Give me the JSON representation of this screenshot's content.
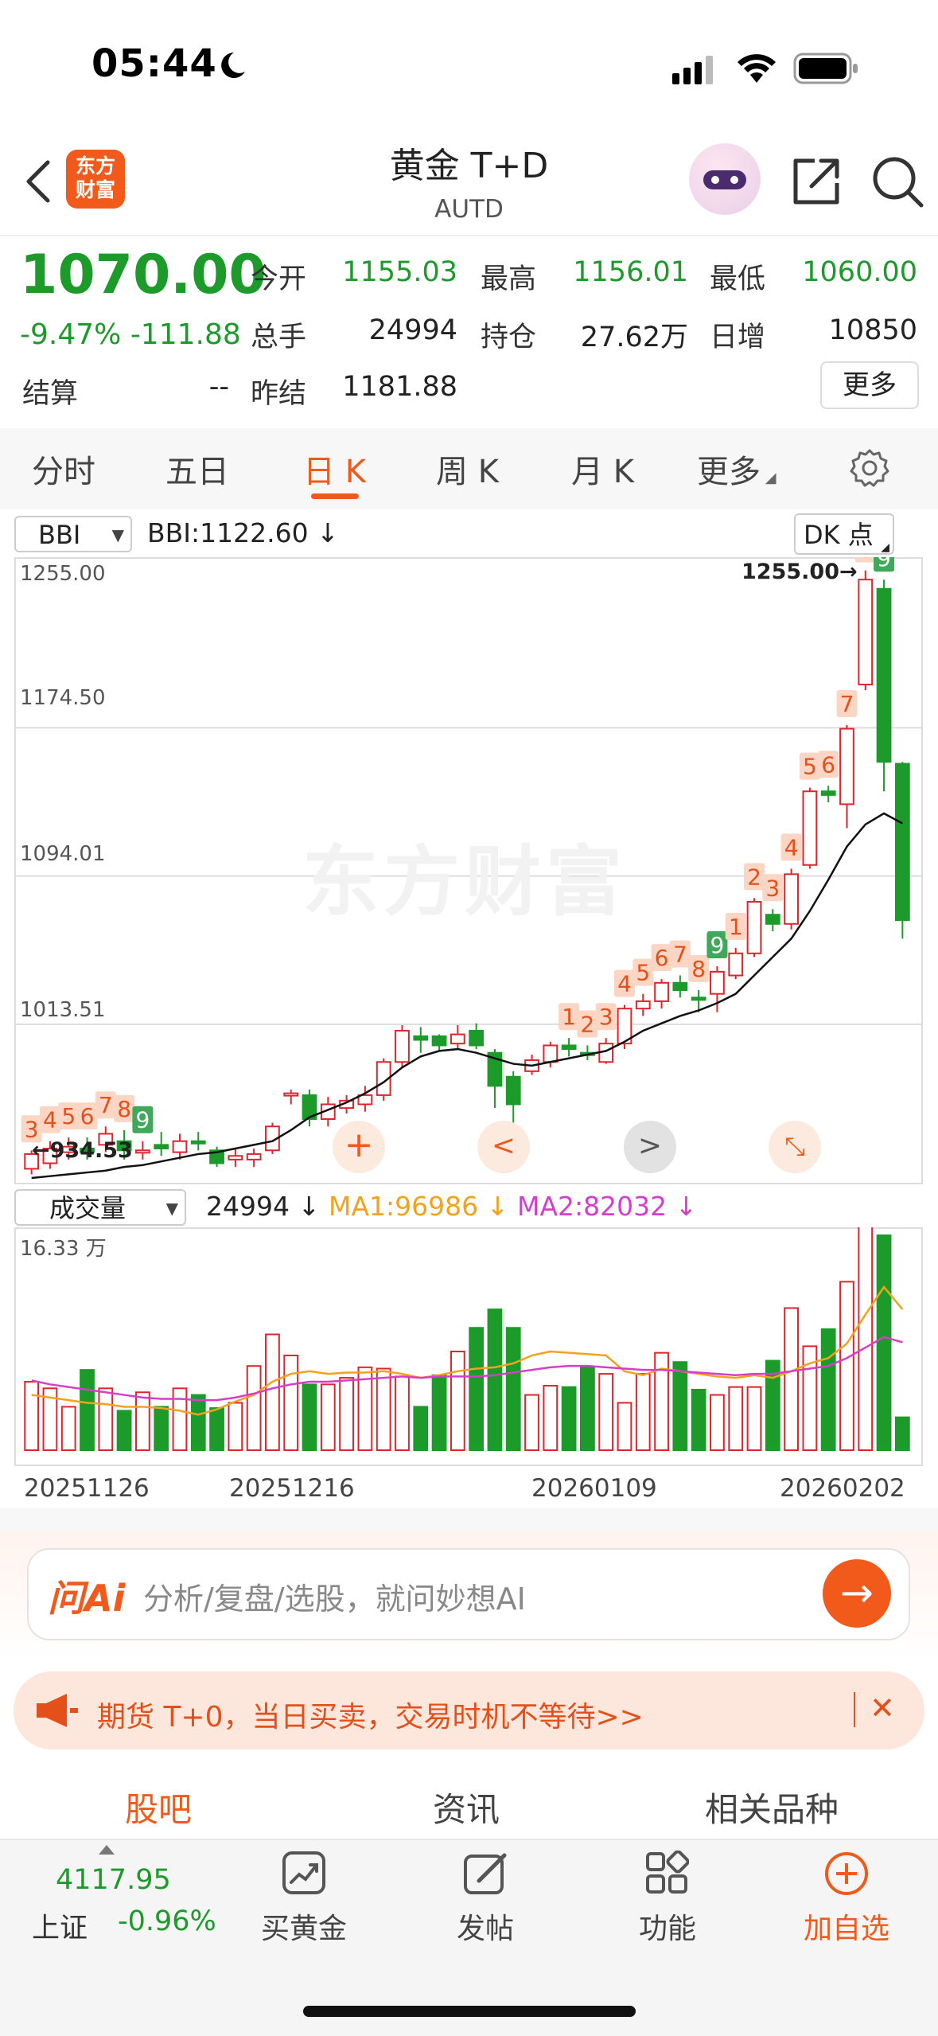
{
  "status": {
    "time": "05:44"
  },
  "header": {
    "title": "黄金 T+D",
    "subtitle": "AUTD",
    "logo_text": "东方财富"
  },
  "quote": {
    "price": "1070.00",
    "change_pct": "-9.47%",
    "change_abs": "-111.88",
    "today_open_label": "今开",
    "today_open": "1155.03",
    "high_label": "最高",
    "high": "1156.01",
    "low_label": "最低",
    "low": "1060.00",
    "volume_label": "总手",
    "volume": "24994",
    "position_label": "持仓",
    "position": "27.62万",
    "daily_inc_label": "日增",
    "daily_inc": "10850",
    "settle_label": "结算",
    "settle": "--",
    "prev_settle_label": "昨结",
    "prev_settle": "1181.88",
    "more_label": "更多"
  },
  "tabs": [
    "分时",
    "五日",
    "日 K",
    "周 K",
    "月 K",
    "更多"
  ],
  "active_tab": "日 K",
  "indicator": {
    "name": "BBI",
    "value_text": "BBI:1122.60 ↓",
    "dk_label": "DK 点"
  },
  "volume_indicator": {
    "name": "成交量",
    "value_text": "24994 ↓",
    "ma1_text": "MA1:96986 ↓",
    "ma2_text": "MA2:82032 ↓"
  },
  "colors": {
    "up": "#e0242c",
    "down": "#1c9a2a",
    "bbi": "#111111",
    "ma1": "#f3a21c",
    "ma2": "#d63ec9",
    "accent": "#f25a1c"
  },
  "chart_data": {
    "type": "candlestick",
    "y_ticks": [
      "1255.00",
      "1174.50",
      "1094.01",
      "1013.51"
    ],
    "high_annotation": "1255.00→",
    "low_annotation": "←934.53",
    "dates": [
      "20251126",
      "20251216",
      "20260109",
      "20260202"
    ],
    "candles": [
      {
        "o": 935,
        "c": 943,
        "h": 945,
        "l": 932,
        "up": true
      },
      {
        "o": 938,
        "c": 946,
        "h": 950,
        "l": 935,
        "up": true
      },
      {
        "o": 944,
        "c": 947,
        "h": 952,
        "l": 940,
        "up": true
      },
      {
        "o": 946,
        "c": 944,
        "h": 952,
        "l": 940,
        "up": false
      },
      {
        "o": 948,
        "c": 954,
        "h": 958,
        "l": 944,
        "up": true
      },
      {
        "o": 950,
        "c": 945,
        "h": 956,
        "l": 940,
        "up": false
      },
      {
        "o": 944,
        "c": 945,
        "h": 950,
        "l": 940,
        "up": true
      },
      {
        "o": 946,
        "c": 948,
        "h": 955,
        "l": 942,
        "up": false
      },
      {
        "o": 944,
        "c": 950,
        "h": 954,
        "l": 940,
        "up": true
      },
      {
        "o": 950,
        "c": 949,
        "h": 955,
        "l": 945,
        "up": false
      },
      {
        "o": 945,
        "c": 938,
        "h": 947,
        "l": 936,
        "up": false
      },
      {
        "o": 940,
        "c": 942,
        "h": 946,
        "l": 936,
        "up": true
      },
      {
        "o": 940,
        "c": 943,
        "h": 946,
        "l": 936,
        "up": true
      },
      {
        "o": 945,
        "c": 958,
        "h": 960,
        "l": 943,
        "up": true
      },
      {
        "o": 975,
        "c": 976,
        "h": 978,
        "l": 970,
        "up": true
      },
      {
        "o": 975,
        "c": 962,
        "h": 978,
        "l": 958,
        "up": false
      },
      {
        "o": 962,
        "c": 970,
        "h": 974,
        "l": 958,
        "up": true
      },
      {
        "o": 968,
        "c": 972,
        "h": 975,
        "l": 965,
        "up": true
      },
      {
        "o": 970,
        "c": 975,
        "h": 980,
        "l": 966,
        "up": true
      },
      {
        "o": 975,
        "c": 993,
        "h": 995,
        "l": 972,
        "up": true
      },
      {
        "o": 993,
        "c": 1010,
        "h": 1013,
        "l": 990,
        "up": true
      },
      {
        "o": 1005,
        "c": 1007,
        "h": 1012,
        "l": 998,
        "up": false
      },
      {
        "o": 1007,
        "c": 1002,
        "h": 1008,
        "l": 999,
        "up": false
      },
      {
        "o": 1003,
        "c": 1008,
        "h": 1013,
        "l": 1000,
        "up": true
      },
      {
        "o": 1010,
        "c": 1002,
        "h": 1014,
        "l": 1000,
        "up": false
      },
      {
        "o": 998,
        "c": 980,
        "h": 1000,
        "l": 968,
        "up": false
      },
      {
        "o": 985,
        "c": 970,
        "h": 988,
        "l": 960,
        "up": false
      },
      {
        "o": 988,
        "c": 994,
        "h": 997,
        "l": 986,
        "up": true
      },
      {
        "o": 993,
        "c": 1002,
        "h": 1004,
        "l": 990,
        "up": true
      },
      {
        "o": 1002,
        "c": 1000,
        "h": 1006,
        "l": 996,
        "up": false
      },
      {
        "o": 997,
        "c": 998,
        "h": 1002,
        "l": 994,
        "up": false
      },
      {
        "o": 993,
        "c": 1003,
        "h": 1006,
        "l": 992,
        "up": true
      },
      {
        "o": 1003,
        "c": 1022,
        "h": 1024,
        "l": 1000,
        "up": true
      },
      {
        "o": 1022,
        "c": 1026,
        "h": 1030,
        "l": 1018,
        "up": true
      },
      {
        "o": 1026,
        "c": 1036,
        "h": 1038,
        "l": 1022,
        "up": true
      },
      {
        "o": 1036,
        "c": 1032,
        "h": 1040,
        "l": 1028,
        "up": false
      },
      {
        "o": 1028,
        "c": 1028,
        "h": 1032,
        "l": 1020,
        "up": false
      },
      {
        "o": 1030,
        "c": 1042,
        "h": 1045,
        "l": 1020,
        "up": true
      },
      {
        "o": 1040,
        "c": 1052,
        "h": 1055,
        "l": 1038,
        "up": true
      },
      {
        "o": 1052,
        "c": 1080,
        "h": 1082,
        "l": 1050,
        "up": true
      },
      {
        "o": 1073,
        "c": 1068,
        "h": 1076,
        "l": 1064,
        "up": false
      },
      {
        "o": 1068,
        "c": 1095,
        "h": 1098,
        "l": 1065,
        "up": true
      },
      {
        "o": 1100,
        "c": 1140,
        "h": 1142,
        "l": 1098,
        "up": true
      },
      {
        "o": 1140,
        "c": 1138,
        "h": 1143,
        "l": 1134,
        "up": false
      },
      {
        "o": 1133,
        "c": 1174,
        "h": 1176,
        "l": 1120,
        "up": true
      },
      {
        "o": 1198,
        "c": 1255,
        "h": 1260,
        "l": 1195,
        "up": true
      },
      {
        "o": 1250,
        "c": 1156,
        "h": 1255,
        "l": 1140,
        "up": false
      },
      {
        "o": 1155,
        "c": 1070,
        "h": 1156,
        "l": 1060,
        "up": false
      }
    ],
    "bbi": [
      930,
      931,
      932,
      933,
      934,
      936,
      937,
      939,
      941,
      943,
      944,
      946,
      948,
      950,
      956,
      963,
      967,
      971,
      976,
      982,
      990,
      996,
      999,
      1000,
      998,
      995,
      992,
      991,
      993,
      995,
      997,
      999,
      1004,
      1010,
      1014,
      1018,
      1021,
      1025,
      1030,
      1040,
      1050,
      1060,
      1075,
      1092,
      1110,
      1122,
      1128,
      1122.6
    ],
    "td_marks": [
      {
        "i": 0,
        "n": "3",
        "g": false
      },
      {
        "i": 1,
        "n": "4",
        "g": false
      },
      {
        "i": 2,
        "n": "5",
        "g": false
      },
      {
        "i": 3,
        "n": "6",
        "g": false
      },
      {
        "i": 4,
        "n": "7",
        "g": false
      },
      {
        "i": 5,
        "n": "8",
        "g": false
      },
      {
        "i": 6,
        "n": "9",
        "g": true
      },
      {
        "i": 29,
        "n": "1",
        "g": false
      },
      {
        "i": 30,
        "n": "2",
        "g": false
      },
      {
        "i": 31,
        "n": "3",
        "g": false
      },
      {
        "i": 32,
        "n": "4",
        "g": false
      },
      {
        "i": 33,
        "n": "5",
        "g": false
      },
      {
        "i": 34,
        "n": "6",
        "g": false
      },
      {
        "i": 35,
        "n": "7",
        "g": false
      },
      {
        "i": 36,
        "n": "8",
        "g": false
      },
      {
        "i": 37,
        "n": "9",
        "g": true
      },
      {
        "i": 38,
        "n": "1",
        "g": false
      },
      {
        "i": 39,
        "n": "2",
        "g": false
      },
      {
        "i": 40,
        "n": "3",
        "g": false
      },
      {
        "i": 41,
        "n": "4",
        "g": false
      },
      {
        "i": 42,
        "n": "5",
        "g": false
      },
      {
        "i": 43,
        "n": "6",
        "g": false
      },
      {
        "i": 44,
        "n": "7",
        "g": false
      },
      {
        "i": 45,
        "n": "8",
        "g": false
      },
      {
        "i": 46,
        "n": "9",
        "g": true
      }
    ],
    "volume_max_label": "16.33 万",
    "volume_ymax": 163300,
    "volumes": [
      52000,
      47000,
      33000,
      61000,
      47000,
      30000,
      44000,
      33000,
      47000,
      42000,
      32000,
      36000,
      64000,
      88000,
      72000,
      50000,
      50000,
      55000,
      63000,
      62000,
      56000,
      33000,
      57000,
      75000,
      93000,
      107000,
      93000,
      42000,
      49000,
      48000,
      63000,
      58000,
      36000,
      58000,
      74000,
      67000,
      46000,
      42000,
      48000,
      48000,
      68000,
      108000,
      79000,
      92000,
      128000,
      192000,
      163300,
      25000
    ],
    "ma1": [
      42000,
      40000,
      38000,
      36000,
      35000,
      33000,
      33000,
      32000,
      30000,
      27000,
      31000,
      37000,
      42000,
      52000,
      58000,
      60000,
      58000,
      59000,
      59000,
      60000,
      58000,
      55000,
      57000,
      60000,
      62000,
      63000,
      66000,
      72000,
      75000,
      74000,
      73000,
      72000,
      60000,
      57000,
      62000,
      60000,
      58000,
      56000,
      55000,
      57000,
      55000,
      60000,
      66000,
      70000,
      81000,
      103000,
      124000,
      107000
    ],
    "ma2": [
      53000,
      50000,
      48000,
      46000,
      44000,
      42000,
      40000,
      39000,
      39000,
      38000,
      38000,
      40000,
      43000,
      47000,
      50000,
      52000,
      52000,
      53000,
      54000,
      55000,
      56000,
      55000,
      56000,
      56000,
      56000,
      57000,
      59000,
      61000,
      63000,
      64000,
      64000,
      63000,
      62000,
      61000,
      61000,
      60000,
      59000,
      58000,
      57000,
      58000,
      58000,
      60000,
      62000,
      64000,
      70000,
      78000,
      86000,
      82000
    ]
  },
  "ai": {
    "logo": "问Ai",
    "placeholder": "分析/复盘/选股，就问妙想AI"
  },
  "banner": {
    "text": "期货 T+0，当日买卖，交易时机不等待>>"
  },
  "subtabs": [
    "股吧",
    "资讯",
    "相关品种"
  ],
  "bottom": {
    "index_value": "4117.95",
    "index_name": "上证",
    "index_change": "-0.96%",
    "nav": [
      "买黄金",
      "发帖",
      "功能",
      "加自选"
    ]
  }
}
